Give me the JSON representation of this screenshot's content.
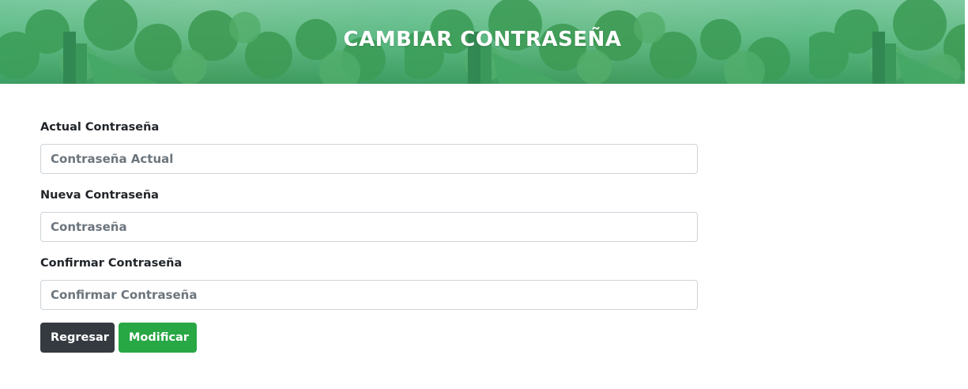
{
  "header": {
    "title": "CAMBIAR CONTRASEÑA"
  },
  "form": {
    "current_password": {
      "label": "Actual Contraseña",
      "placeholder": "Contraseña Actual",
      "value": ""
    },
    "new_password": {
      "label": "Nueva Contraseña",
      "placeholder": "Contraseña",
      "value": ""
    },
    "confirm_password": {
      "label": "Confirmar Contraseña",
      "placeholder": "Confirmar Contraseña",
      "value": ""
    }
  },
  "actions": {
    "back_label": "Regresar",
    "submit_label": "Modificar"
  },
  "colors": {
    "primary_dark": "#343a40",
    "success": "#28a745",
    "banner_green": "#5fb47d"
  }
}
